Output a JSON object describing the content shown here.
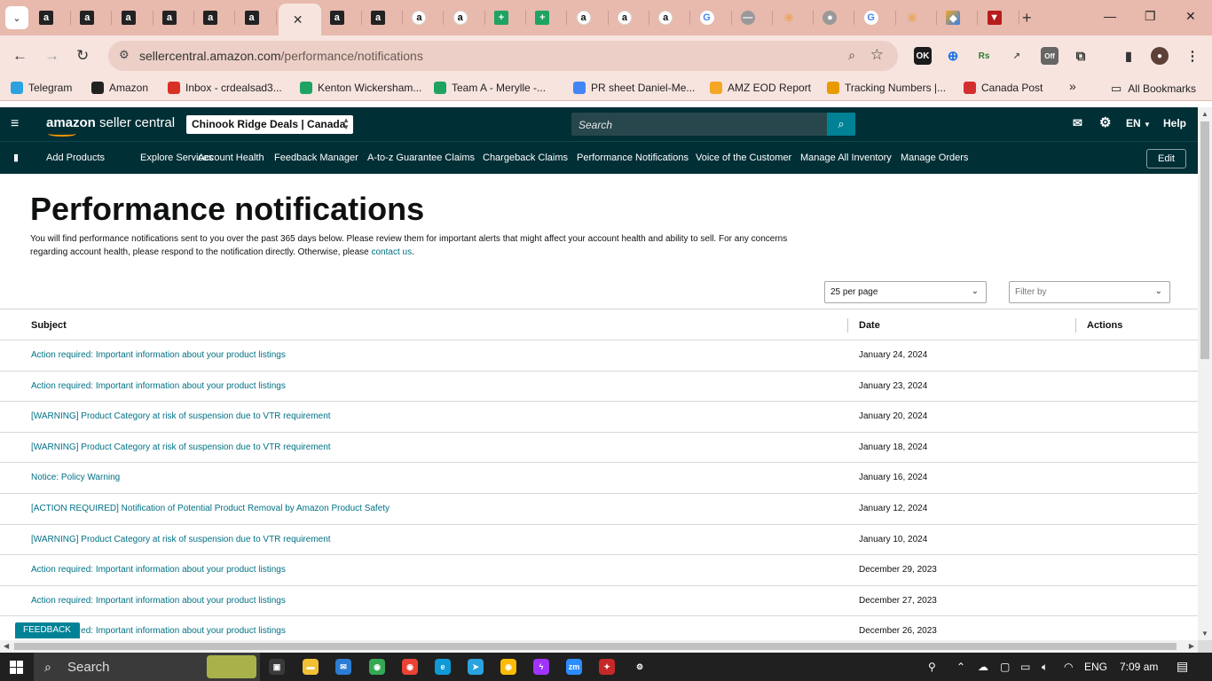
{
  "browser": {
    "tabs": [
      {
        "icon": "amazon-icon",
        "glyph": "a"
      },
      {
        "icon": "amazon-icon",
        "glyph": "a"
      },
      {
        "icon": "amazon-icon",
        "glyph": "a"
      },
      {
        "icon": "amazon-icon",
        "glyph": "a"
      },
      {
        "icon": "amazon-icon",
        "glyph": "a"
      },
      {
        "icon": "amazon-icon",
        "glyph": "a"
      },
      {
        "icon": "close-icon",
        "glyph": "✕",
        "active": true
      },
      {
        "icon": "amazon-icon",
        "glyph": "a"
      },
      {
        "icon": "amazon-icon",
        "glyph": "a"
      },
      {
        "icon": "amazon-smile-icon",
        "glyph": "a"
      },
      {
        "icon": "amazon-smile-icon",
        "glyph": "a"
      },
      {
        "icon": "sheets-icon",
        "glyph": "+"
      },
      {
        "icon": "sheets-icon",
        "glyph": "+"
      },
      {
        "icon": "amazon-smile-icon",
        "glyph": "a"
      },
      {
        "icon": "amazon-smile-icon",
        "glyph": "a"
      },
      {
        "icon": "amazon-smile-icon",
        "glyph": "a"
      },
      {
        "icon": "google-icon",
        "glyph": "G"
      },
      {
        "icon": "dash-icon",
        "glyph": "—"
      },
      {
        "icon": "spark-icon",
        "glyph": "✳"
      },
      {
        "icon": "globe-icon",
        "glyph": "●"
      },
      {
        "icon": "google-icon",
        "glyph": "G"
      },
      {
        "icon": "spark-icon",
        "glyph": "✳"
      },
      {
        "icon": "colorful-app-icon",
        "glyph": "◆"
      },
      {
        "icon": "red-flag-icon",
        "glyph": "▼"
      }
    ],
    "url_host": "sellercentral.amazon.com",
    "url_path": "/performance/notifications",
    "extensions": [
      "OK",
      "⊕",
      "Rs",
      "↗",
      "Off",
      "⧉"
    ],
    "bookmarks": [
      {
        "label": "Telegram",
        "icon": "telegram-icon",
        "color": "#2aa3df"
      },
      {
        "label": "Amazon",
        "icon": "amazon-icon",
        "color": "#222222"
      },
      {
        "label": "Inbox - crdealsad3...",
        "icon": "gmail-icon",
        "color": "#d93025"
      },
      {
        "label": "Kenton Wickersham...",
        "icon": "sheets-icon",
        "color": "#1ea362"
      },
      {
        "label": "Team A - Merylle -...",
        "icon": "sheets-icon",
        "color": "#1ea362"
      },
      {
        "label": "PR sheet Daniel-Me...",
        "icon": "google-icon",
        "color": "#4285f4"
      },
      {
        "label": "AMZ EOD Report",
        "icon": "colorful-app-icon",
        "color": "#f5a623"
      },
      {
        "label": "Tracking Numbers |...",
        "icon": "tracking-icon",
        "color": "#e89a00"
      },
      {
        "label": "Canada Post",
        "icon": "canada-post-icon",
        "color": "#d32f2f"
      }
    ],
    "more_bookmarks": "»",
    "all_bookmarks": "All Bookmarks"
  },
  "seller_central": {
    "logo_brand": "amazon",
    "logo_suffix": "seller central",
    "store_name": "Chinook Ridge Deals | Canada",
    "search_placeholder": "Search",
    "language": "EN",
    "help": "Help",
    "nav_links": [
      "Add Products",
      "Explore Services",
      "Account Health",
      "Feedback Manager",
      "A-to-z Guarantee Claims",
      "Chargeback Claims",
      "Performance Notifications",
      "Voice of the Customer",
      "Manage All Inventory",
      "Manage Orders"
    ],
    "edit_label": "Edit"
  },
  "content": {
    "title": "Performance notifications",
    "intro_text": "You will find performance notifications sent to you over the past 365 days below. Please review them for important alerts that might affect your account health and ability to sell. For any concerns regarding account health, please respond to the notification directly. Otherwise, please ",
    "contact_link": "contact us",
    "intro_end": ".",
    "per_page": "25 per page",
    "filter_placeholder": "Filter by",
    "columns": {
      "subject": "Subject",
      "date": "Date",
      "actions": "Actions"
    },
    "rows": [
      {
        "subject": "Action required: Important information about your product listings",
        "date": "January 24, 2024"
      },
      {
        "subject": "Action required: Important information about your product listings",
        "date": "January 23, 2024"
      },
      {
        "subject": "[WARNING] Product Category at risk of suspension due to VTR requirement",
        "date": "January 20, 2024"
      },
      {
        "subject": "[WARNING] Product Category at risk of suspension due to VTR requirement",
        "date": "January 18, 2024"
      },
      {
        "subject": "Notice: Policy Warning",
        "date": "January 16, 2024"
      },
      {
        "subject": "[ACTION REQUIRED] Notification of Potential Product Removal by Amazon Product Safety",
        "date": "January 12, 2024"
      },
      {
        "subject": "[WARNING] Product Category at risk of suspension due to VTR requirement",
        "date": "January 10, 2024"
      },
      {
        "subject": "Action required: Important information about your product listings",
        "date": "December 29, 2023"
      },
      {
        "subject": "Action required: Important information about your product listings",
        "date": "December 27, 2023"
      },
      {
        "subject": "Action required: Important information about your product listings",
        "date": "December 26, 2023"
      }
    ],
    "feedback_label": "FEEDBACK ✕"
  },
  "taskbar": {
    "search_label": "Search",
    "language": "ENG",
    "time": "7:09 am",
    "apps": [
      {
        "name": "task-view-icon",
        "color": "#3a3a3a",
        "glyph": "▣"
      },
      {
        "name": "file-explorer-icon",
        "color": "#f2c037",
        "glyph": "▬"
      },
      {
        "name": "mail-icon",
        "color": "#2b7cd3",
        "glyph": "✉"
      },
      {
        "name": "chrome-icon",
        "color": "#34a853",
        "glyph": "◉"
      },
      {
        "name": "chrome-icon",
        "color": "#ea4335",
        "glyph": "◉"
      },
      {
        "name": "edge-icon",
        "color": "#0f9ad5",
        "glyph": "e"
      },
      {
        "name": "telegram-icon",
        "color": "#2aa3df",
        "glyph": "➤"
      },
      {
        "name": "chrome-icon",
        "color": "#fbbc05",
        "glyph": "◉"
      },
      {
        "name": "messenger-icon",
        "color": "#a033ff",
        "glyph": "ϟ"
      },
      {
        "name": "zoom-icon",
        "color": "#2d8cff",
        "glyph": "zm"
      },
      {
        "name": "app-icon",
        "color": "#c62828",
        "glyph": "✦"
      },
      {
        "name": "settings-icon",
        "color": "#202020",
        "glyph": "⚙"
      }
    ]
  }
}
